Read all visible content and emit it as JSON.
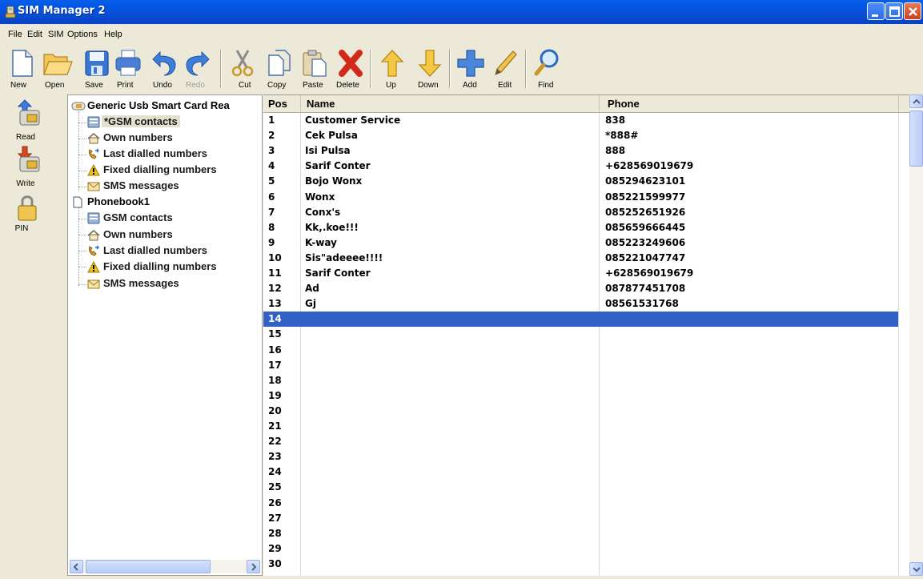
{
  "window": {
    "title": "SIM Manager 2"
  },
  "menu": [
    "File",
    "Edit",
    "SIM",
    "Options",
    "Help"
  ],
  "toolbar": {
    "new": "New",
    "open": "Open",
    "save": "Save",
    "print": "Print",
    "undo": "Undo",
    "redo": "Redo",
    "cut": "Cut",
    "copy": "Copy",
    "paste": "Paste",
    "delete": "Delete",
    "up": "Up",
    "down": "Down",
    "add": "Add",
    "edit": "Edit",
    "find": "Find"
  },
  "leftbar": {
    "read": "Read",
    "write": "Write",
    "pin": "PIN"
  },
  "tree": {
    "reader": "Generic Usb Smart Card Rea",
    "sim": [
      "*GSM contacts",
      "Own numbers",
      "Last dialled numbers",
      "Fixed dialling numbers",
      "SMS messages"
    ],
    "phonebook": "Phonebook1",
    "pb": [
      "GSM contacts",
      "Own numbers",
      "Last dialled numbers",
      "Fixed dialling numbers",
      "SMS messages"
    ]
  },
  "grid": {
    "headers": {
      "pos": "Pos",
      "name": "Name",
      "phone": "Phone"
    },
    "rows": [
      {
        "pos": "1",
        "name": "Customer Service",
        "phone": "838"
      },
      {
        "pos": "2",
        "name": "Cek Pulsa",
        "phone": "*888#"
      },
      {
        "pos": "3",
        "name": "Isi Pulsa",
        "phone": "888"
      },
      {
        "pos": "4",
        "name": "Sarif Conter",
        "phone": "+628569019679"
      },
      {
        "pos": "5",
        "name": "Bojo Wonx",
        "phone": "085294623101"
      },
      {
        "pos": "6",
        "name": "Wonx",
        "phone": "085221599977"
      },
      {
        "pos": "7",
        "name": "Conx's",
        "phone": "085252651926"
      },
      {
        "pos": "8",
        "name": "Kk,.koe!!!",
        "phone": "085659666445"
      },
      {
        "pos": "9",
        "name": "K-way",
        "phone": "085223249606"
      },
      {
        "pos": "10",
        "name": "Sis\"adeeee!!!!",
        "phone": "085221047747"
      },
      {
        "pos": "11",
        "name": "Sarif Conter",
        "phone": "+628569019679"
      },
      {
        "pos": "12",
        "name": "Ad",
        "phone": "087877451708"
      },
      {
        "pos": "13",
        "name": "Gj",
        "phone": "08561531768"
      },
      {
        "pos": "14",
        "name": "",
        "phone": ""
      },
      {
        "pos": "15",
        "name": "",
        "phone": ""
      },
      {
        "pos": "16",
        "name": "",
        "phone": ""
      },
      {
        "pos": "17",
        "name": "",
        "phone": ""
      },
      {
        "pos": "18",
        "name": "",
        "phone": ""
      },
      {
        "pos": "19",
        "name": "",
        "phone": ""
      },
      {
        "pos": "20",
        "name": "",
        "phone": ""
      },
      {
        "pos": "21",
        "name": "",
        "phone": ""
      },
      {
        "pos": "22",
        "name": "",
        "phone": ""
      },
      {
        "pos": "23",
        "name": "",
        "phone": ""
      },
      {
        "pos": "24",
        "name": "",
        "phone": ""
      },
      {
        "pos": "25",
        "name": "",
        "phone": ""
      },
      {
        "pos": "26",
        "name": "",
        "phone": ""
      },
      {
        "pos": "27",
        "name": "",
        "phone": ""
      },
      {
        "pos": "28",
        "name": "",
        "phone": ""
      },
      {
        "pos": "29",
        "name": "",
        "phone": ""
      },
      {
        "pos": "30",
        "name": "",
        "phone": ""
      }
    ],
    "selected_pos": "14"
  },
  "colors": {
    "selection": "#3161c4",
    "titlebar": "#0058e6"
  }
}
